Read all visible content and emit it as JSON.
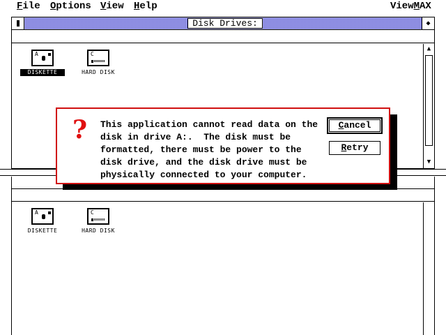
{
  "menubar": {
    "items": [
      {
        "label": "File",
        "hotkey": "F",
        "rest": "ile"
      },
      {
        "label": "Options",
        "hotkey": "O",
        "rest": "ptions"
      },
      {
        "label": "View",
        "hotkey": "V",
        "rest": "iew"
      },
      {
        "label": "Help",
        "hotkey": "H",
        "rest": "elp"
      }
    ],
    "app_name_prefix": "View",
    "app_name_hotkey": "M",
    "app_name_rest": "AX"
  },
  "window": {
    "title": "Disk Drives:",
    "maximize_glyph": "◆",
    "sysmenu_label": ""
  },
  "top_drives": [
    {
      "letter": "A",
      "label": "DISKETTE",
      "selected": true
    },
    {
      "letter": "C",
      "label": "HARD DISK",
      "selected": false
    }
  ],
  "bottom_drives": [
    {
      "letter": "A",
      "label": "DISKETTE"
    },
    {
      "letter": "C",
      "label": "HARD DISK"
    }
  ],
  "scroll": {
    "up_glyph": "▲",
    "down_glyph": "▼"
  },
  "dialog": {
    "icon_glyph": "?",
    "message": "This application cannot read data on the\ndisk in drive A:.  The disk must be\nformatted, there must be power to the\ndisk drive, and the disk drive must be\nphysically connected to your computer.",
    "cancel_label": "Cancel",
    "cancel_hotkey": "C",
    "cancel_rest": "ancel",
    "retry_label": "Retry",
    "retry_hotkey": "R",
    "retry_rest": "etry"
  },
  "colors": {
    "title_bar": "#2828c8",
    "dialog_border": "#d01010",
    "question_mark": "#e01010"
  }
}
